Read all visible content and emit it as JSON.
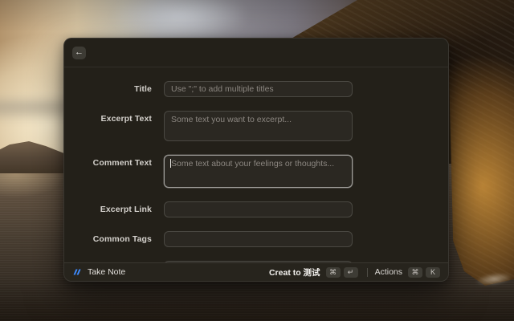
{
  "window": {
    "header": {
      "back_icon": "←"
    },
    "form": {
      "fields": [
        {
          "label": "Title",
          "placeholder": "Use \";\" to add multiple titles",
          "type": "input"
        },
        {
          "label": "Excerpt Text",
          "placeholder": "Some text you want to excerpt...",
          "type": "textarea"
        },
        {
          "label": "Comment Text",
          "placeholder": "Some text about your feelings or thoughts...",
          "type": "textarea",
          "focused": true
        },
        {
          "label": "Excerpt Link",
          "placeholder": "",
          "type": "input"
        },
        {
          "label": "Common Tags",
          "placeholder": "",
          "type": "input"
        },
        {
          "label": "",
          "placeholder": "",
          "type": "input",
          "partial": true
        }
      ]
    },
    "footer": {
      "app_name": "Take Note",
      "primary_action": {
        "label": "Creat to 测试",
        "keys": [
          "⌘",
          "↵"
        ]
      },
      "secondary_action": {
        "label": "Actions",
        "keys": [
          "⌘",
          "K"
        ]
      }
    }
  },
  "colors": {
    "logo_blue": "#3E8BFF",
    "window_bg": "#232019",
    "focus_border": "#A9A49D"
  }
}
